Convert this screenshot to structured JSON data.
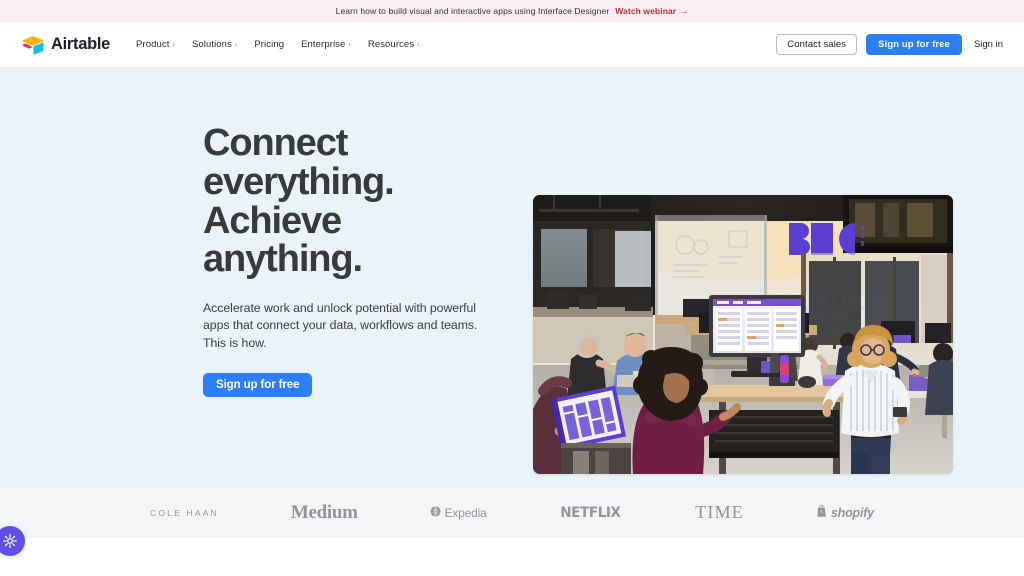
{
  "banner": {
    "text": "Learn how to build visual and interactive apps using Interface Designer",
    "link_label": "Watch webinar",
    "link_arrow": "→",
    "background": "#fbeef1",
    "link_color": "#b5302e"
  },
  "nav": {
    "brand_name": "Airtable",
    "brand_logo_icon": "airtable-logo-icon",
    "links": [
      {
        "label": "Product",
        "has_chevron": true
      },
      {
        "label": "Solutions",
        "has_chevron": true
      },
      {
        "label": "Pricing",
        "has_chevron": false
      },
      {
        "label": "Enterprise",
        "has_chevron": true
      },
      {
        "label": "Resources",
        "has_chevron": true
      }
    ],
    "chevron_glyph": "›",
    "contact_sales_label": "Contact sales",
    "signup_label": "Sign up for free",
    "signin_label": "Sign in",
    "primary_color": "#2d7ff9"
  },
  "hero": {
    "title_line1": "Connect",
    "title_line2": "everything.",
    "title_line3": "Achieve",
    "title_line4": "anything.",
    "subtitle": "Accelerate work and unlock potential with powerful apps that connect your data, workflows and teams. This is how.",
    "cta_label": "Sign up for free",
    "background": "#e9f3fa",
    "photo_alt": "Office workspace with coworkers collaborating at standing desks"
  },
  "logostrip": {
    "background": "#f4f5f7",
    "logos": [
      {
        "name": "cole-haan",
        "label": "COLE HAAN"
      },
      {
        "name": "medium",
        "label": "Medium"
      },
      {
        "name": "expedia",
        "label": "Expedia"
      },
      {
        "name": "netflix",
        "label": "NETFLIX"
      },
      {
        "name": "time",
        "label": "TIME"
      },
      {
        "name": "shopify",
        "label": "shopify"
      }
    ]
  },
  "accessibility_widget": {
    "icon": "accessibility-sun-icon",
    "color": "#6050e8"
  }
}
